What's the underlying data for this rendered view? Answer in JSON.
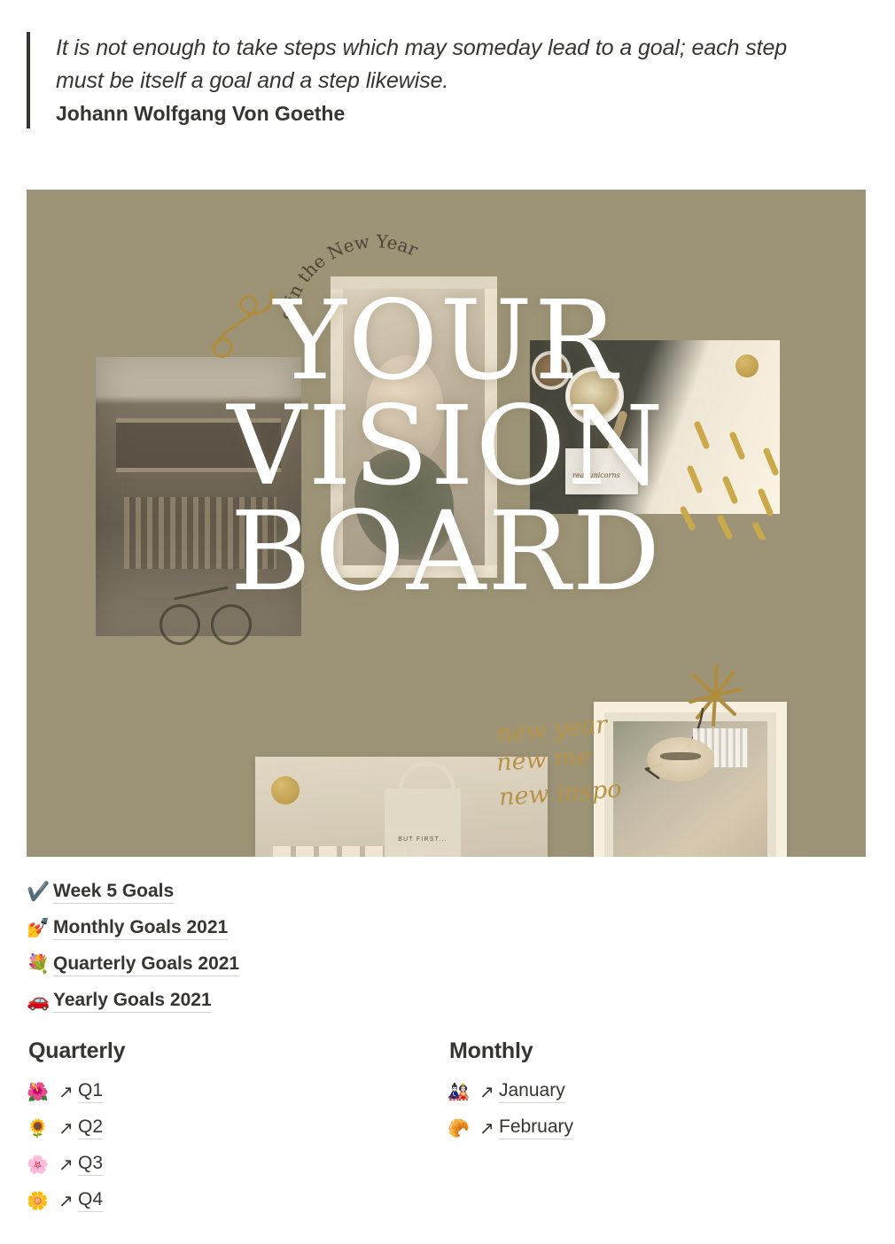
{
  "quote": {
    "text": "It is not enough to take steps which may someday lead to a goal; each step must be itself a goal and a step likewise.",
    "author": "Johann Wolfgang Von Goethe"
  },
  "board": {
    "title_line_1": "YOUR",
    "title_line_2": "VISION",
    "title_line_3": "BOARD",
    "background_color": "#9d9478",
    "title_color": "#ffffff",
    "gold_color": "#b79242",
    "curved_text": "g in the New Year",
    "script_1": "new year",
    "script_2": "new me",
    "script_3": "new inspo",
    "note_card_text": "real unicorns",
    "tote_text": "BUT FIRST..."
  },
  "links": [
    {
      "emoji": "✔️",
      "icon_name": "check-mark-icon",
      "label": "Week 5 Goals"
    },
    {
      "emoji": "💅",
      "icon_name": "nail-polish-icon",
      "label": "Monthly Goals 2021"
    },
    {
      "emoji": "💐",
      "icon_name": "bouquet-icon",
      "label": "Quarterly Goals 2021"
    },
    {
      "emoji": "🚗",
      "icon_name": "car-icon",
      "label": "Yearly Goals 2021"
    }
  ],
  "columns": [
    {
      "title": "Quarterly",
      "items": [
        {
          "emoji": "🌺",
          "icon_name": "hibiscus-icon",
          "arrow": "↗",
          "label": "Q1"
        },
        {
          "emoji": "🌻",
          "icon_name": "sunflower-icon",
          "arrow": "↗",
          "label": "Q2"
        },
        {
          "emoji": "🌸",
          "icon_name": "cherry-blossom-icon",
          "arrow": "↗",
          "label": "Q3"
        },
        {
          "emoji": "🌼",
          "icon_name": "blossom-icon",
          "arrow": "↗",
          "label": "Q4"
        }
      ]
    },
    {
      "title": "Monthly",
      "items": [
        {
          "emoji": "🎎",
          "icon_name": "japanese-dolls-icon",
          "arrow": "↗",
          "label": "January"
        },
        {
          "emoji": "🥐",
          "icon_name": "croissant-icon",
          "arrow": "↗",
          "label": "February"
        }
      ]
    }
  ]
}
